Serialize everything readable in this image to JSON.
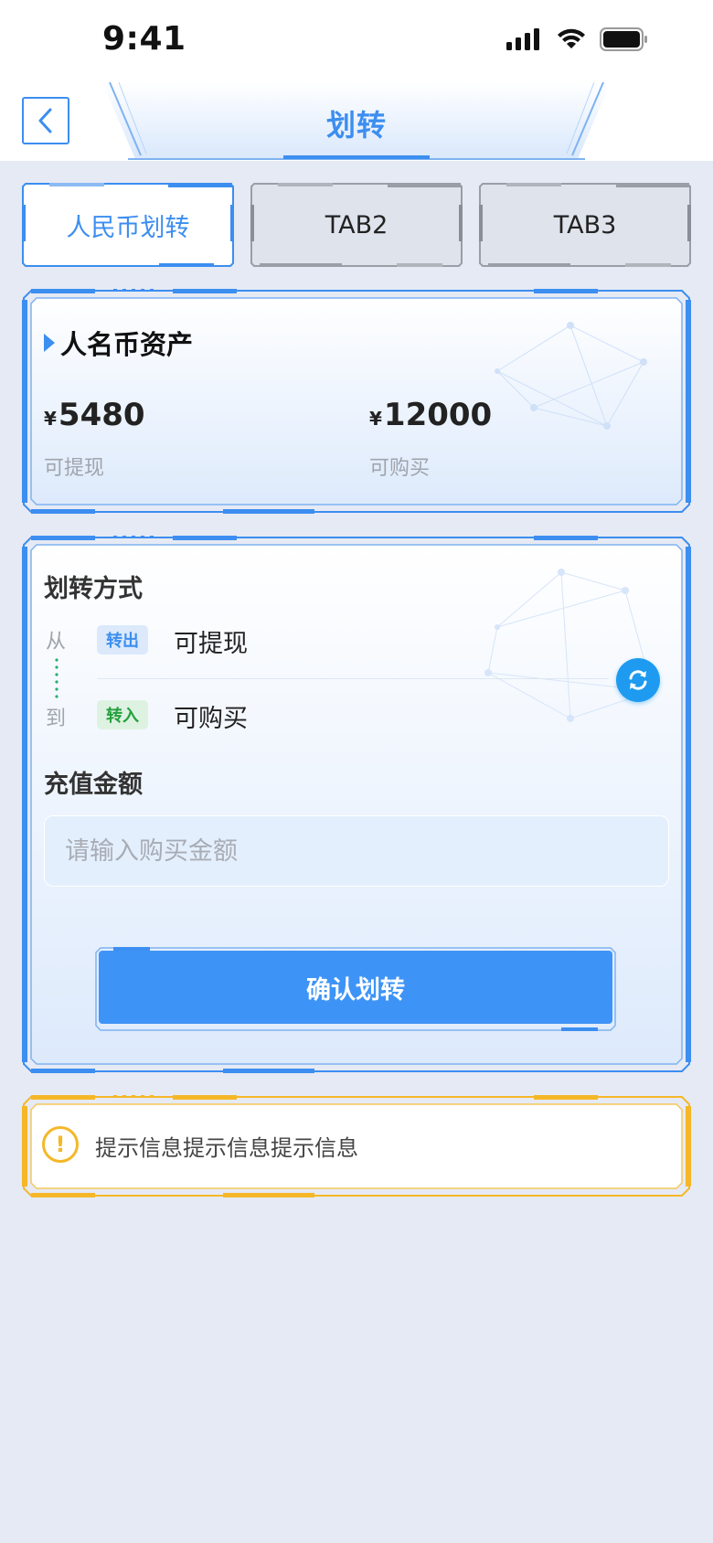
{
  "status_bar": {
    "time": "9:41"
  },
  "nav": {
    "title": "划转",
    "back_icon": "chevron-left-icon"
  },
  "tabs": [
    {
      "label": "人民币划转",
      "active": true
    },
    {
      "label": "TAB2",
      "active": false
    },
    {
      "label": "TAB3",
      "active": false
    }
  ],
  "assets": {
    "title": "人名币资产",
    "currency_symbol": "¥",
    "withdrawable": {
      "amount": "5480",
      "label": "可提现"
    },
    "purchasable": {
      "amount": "12000",
      "label": "可购买"
    }
  },
  "transfer": {
    "method_label": "划转方式",
    "from_label": "从",
    "to_label": "到",
    "out_badge": "转出",
    "in_badge": "转入",
    "from_account": "可提现",
    "to_account": "可购买",
    "swap_icon": "swap-refresh-icon",
    "amount_label": "充值金额",
    "amount_placeholder": "请输入购买金额",
    "confirm_label": "确认划转"
  },
  "tip": {
    "text": "提示信息提示信息提示信息",
    "icon": "exclamation-circle-icon"
  },
  "colors": {
    "accent": "#3c8ef0",
    "button": "#3e94f6",
    "page_bg": "#e6eaf4",
    "warning": "#f5b728",
    "success": "#25a03e"
  }
}
